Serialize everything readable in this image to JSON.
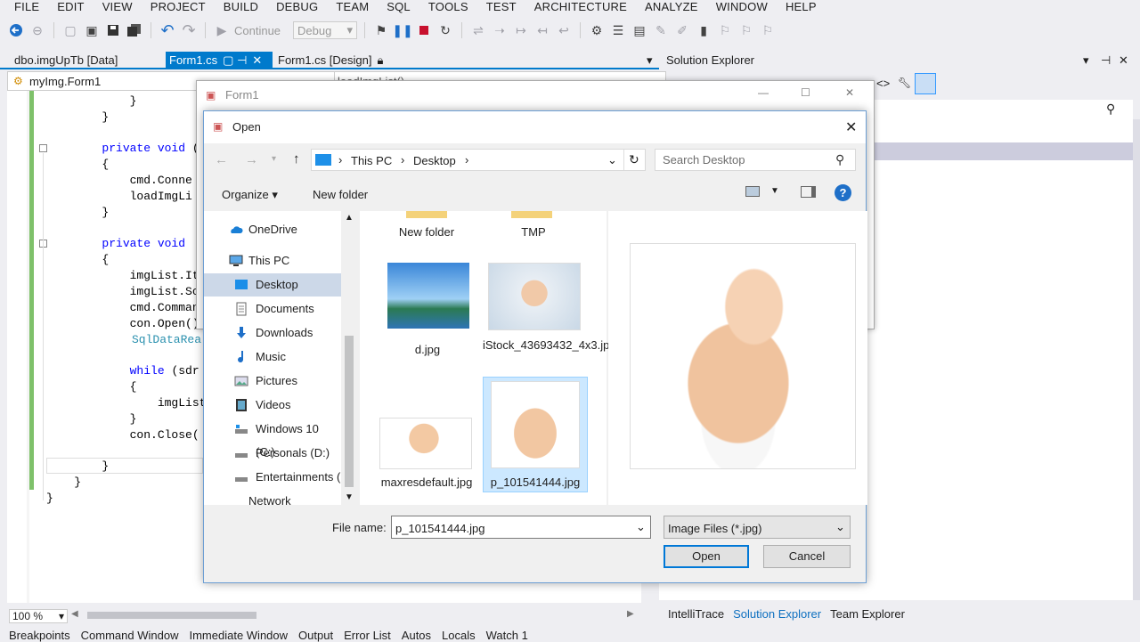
{
  "menu": [
    "FILE",
    "EDIT",
    "VIEW",
    "PROJECT",
    "BUILD",
    "DEBUG",
    "TEAM",
    "SQL",
    "TOOLS",
    "TEST",
    "ARCHITECTURE",
    "ANALYZE",
    "WINDOW",
    "HELP"
  ],
  "toolbar": {
    "continue_label": "Continue",
    "config_value": "Debug"
  },
  "tabs": {
    "tab1": "dbo.imgUpTb [Data]",
    "tab2": "Form1.cs",
    "tab3": "Form1.cs [Design]"
  },
  "navbar": {
    "class_scope": "myImg.Form1",
    "member_scope": "loadImgList()"
  },
  "code": {
    "l1": "            }",
    "l2": "        }",
    "l3a": "        ",
    "l3b": "private void",
    "l3c": " (",
    "l4": "        {",
    "l5": "            cmd.Conne",
    "l6": "            loadImgLi",
    "l7": "        }",
    "l8a": "        ",
    "l8b": "private void",
    "l8c": " ",
    "l9": "        {",
    "l10": "            imgList.It",
    "l11": "            imgList.So",
    "l12": "            cmd.Comman",
    "l13": "            con.Open()",
    "l14": "SqlDataRea",
    "l15a": "            ",
    "l15b": "while",
    "l15c": " (sdr",
    "l16": "            {",
    "l17": "                imgList",
    "l18": "            }",
    "l19": "            con.Close(",
    "l20": "        }",
    "l21": "    }",
    "l22": "}"
  },
  "zoom": "100 %",
  "bottom_tabs": [
    "Breakpoints",
    "Command Window",
    "Immediate Window",
    "Output",
    "Error List",
    "Autos",
    "Locals",
    "Watch 1"
  ],
  "solution_explorer": {
    "title": "Solution Explorer",
    "tabs": [
      "IntelliTrace",
      "Solution Explorer",
      "Team Explorer"
    ]
  },
  "form1": {
    "title": "Form1"
  },
  "dialog": {
    "title": "Open",
    "address": {
      "pc": "This PC",
      "folder": "Desktop"
    },
    "search_placeholder": "Search Desktop",
    "organize": "Organize",
    "new_folder": "New folder",
    "nav": [
      "OneDrive",
      "This PC",
      "Desktop",
      "Documents",
      "Downloads",
      "Music",
      "Pictures",
      "Videos",
      "Windows 10 (C:)",
      "Personals (D:)",
      "Entertainments (",
      "Network"
    ],
    "files": {
      "f1": "New folder",
      "f2": "TMP",
      "f3": "d.jpg",
      "f4": "iStock_43693432_4x3.jpg",
      "f5": "maxresdefault.jpg",
      "f6": "p_101541444.jpg"
    },
    "filename_label": "File name:",
    "filename_value": "p_101541444.jpg",
    "filter": "Image Files (*.jpg)",
    "open_button": "Open",
    "cancel_button": "Cancel"
  },
  "colors": {
    "accent": "#007acc",
    "selection": "#cce8ff",
    "gutter": "#7ec16a",
    "keyword": "#0000ff",
    "type": "#2b91af"
  }
}
